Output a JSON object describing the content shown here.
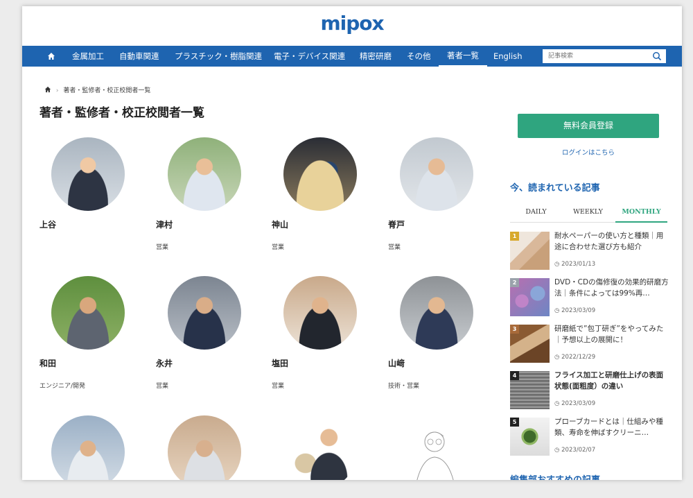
{
  "header": {
    "logo": "mipox"
  },
  "nav": {
    "items": [
      "金属加工",
      "自動車関連",
      "プラスチック・樹脂関連",
      "電子・デバイス関連",
      "精密研磨",
      "その他",
      "著者一覧",
      "English"
    ],
    "active_index": 6,
    "search_placeholder": "記事検索"
  },
  "breadcrumb": {
    "current": "著者・監修者・校正校閲者一覧"
  },
  "page_title": "著者・監修者・校正校閲者一覧",
  "authors": [
    {
      "name": "上谷",
      "role": ""
    },
    {
      "name": "津村",
      "role": "営業"
    },
    {
      "name": "神山",
      "role": "営業"
    },
    {
      "name": "脊戸",
      "role": "営業"
    },
    {
      "name": "和田",
      "role": "エンジニア/開発"
    },
    {
      "name": "永井",
      "role": "営業"
    },
    {
      "name": "塩田",
      "role": "営業"
    },
    {
      "name": "山﨑",
      "role": "技術・営業"
    },
    {
      "name": "",
      "role": ""
    },
    {
      "name": "",
      "role": ""
    },
    {
      "name": "",
      "role": ""
    },
    {
      "name": "",
      "role": ""
    }
  ],
  "sidebar": {
    "register_button": "無料会員登録",
    "login_link": "ログインはこちら",
    "popular_title": "今、読まれている記事",
    "tabs": [
      "DAILY",
      "WEEKLY",
      "MONTHLY"
    ],
    "active_tab": 2,
    "ranking": [
      {
        "rank": "1",
        "title": "耐水ペーパーの使い方と種類｜用途に合わせた選び方も紹介",
        "date": "2023/01/13"
      },
      {
        "rank": "2",
        "title": "DVD・CDの傷修復の効果的研磨方法｜条件によっては99%再…",
        "date": "2023/03/09"
      },
      {
        "rank": "3",
        "title": "研磨紙で”包丁研ぎ”をやってみた｜予想以上の展開に！",
        "date": "2022/12/29"
      },
      {
        "rank": "4",
        "title": "フライス加工と研磨仕上げの表面状態(面粗度）の違い",
        "date": "2023/03/09"
      },
      {
        "rank": "5",
        "title": "プローブカードとは｜仕組みや種類、寿命を伸ばすクリーニ…",
        "date": "2023/02/07"
      }
    ],
    "bottom_title": "編集部おすすめの記事"
  },
  "colors": {
    "brand": "#1e64b0",
    "accent": "#2fa57f"
  }
}
